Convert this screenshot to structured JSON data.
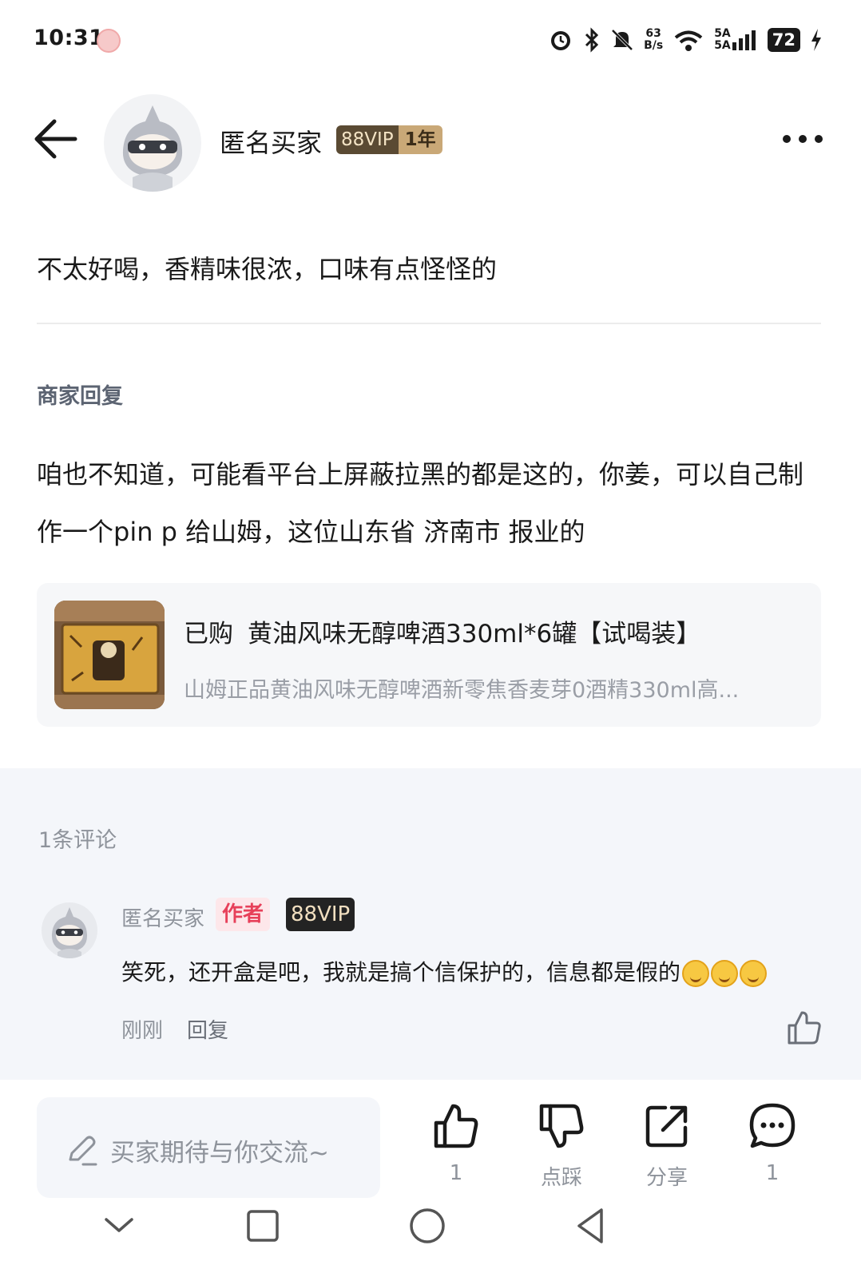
{
  "status_bar": {
    "time": "10:31",
    "net_speed_value": "63",
    "net_speed_unit": "B/s",
    "signal_label_top": "5A",
    "signal_label_bottom": "5A",
    "battery": "72"
  },
  "header": {
    "user_name": "匿名买家",
    "vip_label": "88VIP",
    "vip_years": "1年"
  },
  "review": {
    "text": "不太好喝，香精味很浓，口味有点怪怪的"
  },
  "merchant": {
    "title": "商家回复",
    "reply": "咱也不知道，可能看平台上屏蔽拉黑的都是这的，你姜，可以自己制作一个pin p 给山姆，这位山东省  济南市  报业的"
  },
  "product": {
    "bought_label": "已购",
    "title": "黄油风味无醇啤酒330ml*6罐【试喝装】",
    "subtitle": "山姆正品黄油风味无醇啤酒新零焦香麦芽0酒精330ml高..."
  },
  "comments": {
    "count_label": "1条评论",
    "items": [
      {
        "name": "匿名买家",
        "author_tag": "作者",
        "vip_tag": "88VIP",
        "text": "笑死，还开盒是吧，我就是搞个信保护的，信息都是假的",
        "time": "刚刚",
        "reply_label": "回复"
      }
    ]
  },
  "bottom_bar": {
    "input_placeholder": "买家期待与你交流~",
    "like_count": "1",
    "dislike_label": "点踩",
    "share_label": "分享",
    "comment_count": "1"
  },
  "colors": {
    "accent_red": "#e7405a",
    "vip_gold": "#c9a877",
    "muted_text": "#8e939b",
    "section_bg": "#f4f6fa"
  }
}
